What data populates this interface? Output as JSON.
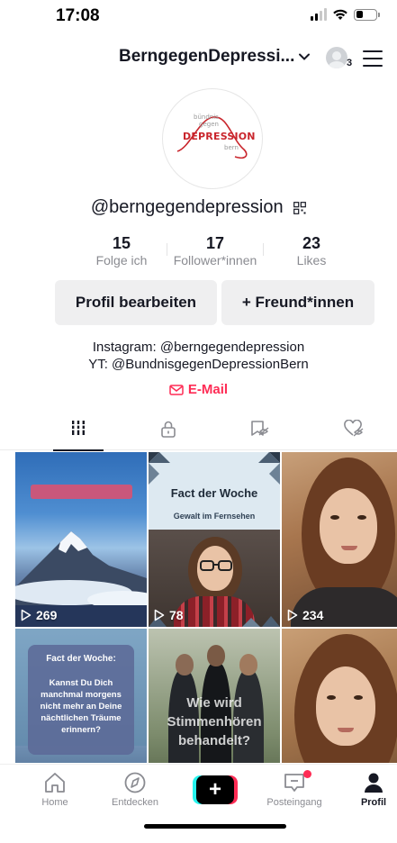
{
  "status_bar": {
    "time": "17:08"
  },
  "header": {
    "account_name": "BerngegenDepressi...",
    "notification_count": "3"
  },
  "profile": {
    "logo_line1": "bündnis",
    "logo_line2": "gegen",
    "logo_main": "DEPRESSION",
    "logo_line3": "bern",
    "username": "@berngegendepression",
    "stats": [
      {
        "value": "15",
        "label": "Folge ich"
      },
      {
        "value": "17",
        "label": "Follower*innen"
      },
      {
        "value": "23",
        "label": "Likes"
      }
    ],
    "edit_button": "Profil bearbeiten",
    "friends_button": "+ Freund*innen",
    "bio_line1": "Instagram: @berngegendepression",
    "bio_line2": "YT: @BundnisgegenDepressionBern",
    "email_label": "E-Mail"
  },
  "tabs": [
    {
      "icon": "grid-icon",
      "active": true
    },
    {
      "icon": "lock-icon",
      "active": false
    },
    {
      "icon": "hidden-repost-icon",
      "active": false
    },
    {
      "icon": "hidden-likes-icon",
      "active": false
    }
  ],
  "videos": [
    {
      "views": "269"
    },
    {
      "views": "78",
      "title": "Fact der Woche",
      "subtitle": "Gewalt im Fernsehen"
    },
    {
      "views": "234"
    },
    {
      "title": "Fact der Woche:",
      "text": "Kannst Du Dich manchmal morgens nicht mehr an Deine nächtlichen Träume erinnern?"
    },
    {
      "text_line1": "Wie wird",
      "text_line2": "Stimmenhören",
      "text_line3": "behandelt?"
    },
    {}
  ],
  "bottom_nav": [
    {
      "label": "Home"
    },
    {
      "label": "Entdecken"
    },
    {
      "label": "Posteingang"
    },
    {
      "label": "Profil"
    }
  ],
  "colors": {
    "accent": "#fe2c55",
    "cyan": "#25f4ee",
    "text": "#161823",
    "muted": "#8a8b91",
    "button_bg": "#efeff0"
  }
}
